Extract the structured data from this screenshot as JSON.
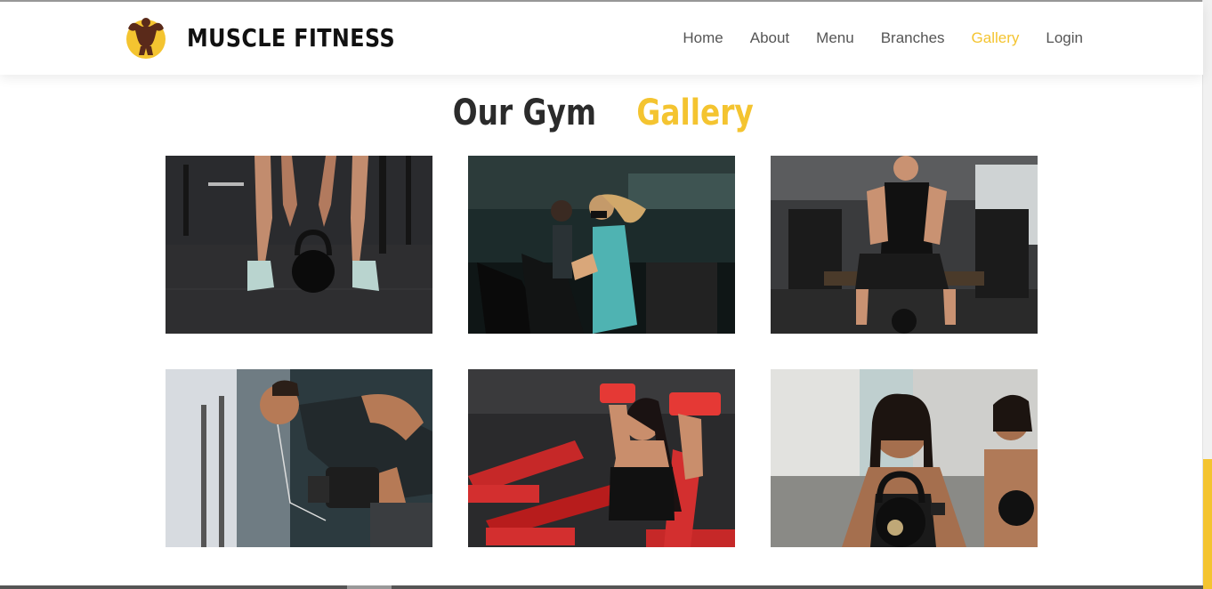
{
  "brand": {
    "name": "MUSCLE FITNESS",
    "logo_icon": "bodybuilder-logo-icon"
  },
  "nav": {
    "items": [
      {
        "label": "Home"
      },
      {
        "label": "About"
      },
      {
        "label": "Menu"
      },
      {
        "label": "Branches"
      },
      {
        "label": "Gallery",
        "active": true
      },
      {
        "label": "Login"
      }
    ]
  },
  "section": {
    "title_part1": "Our Gym",
    "title_part2": "Gallery"
  },
  "colors": {
    "accent": "#f4c430",
    "dark": "#2b2b2b"
  },
  "gallery": {
    "images": [
      {
        "alt": "kettlebell lift"
      },
      {
        "alt": "treadmill running"
      },
      {
        "alt": "man on bench"
      },
      {
        "alt": "dumbbell row"
      },
      {
        "alt": "woman dumbbell press"
      },
      {
        "alt": "kettlebell squat"
      }
    ]
  }
}
